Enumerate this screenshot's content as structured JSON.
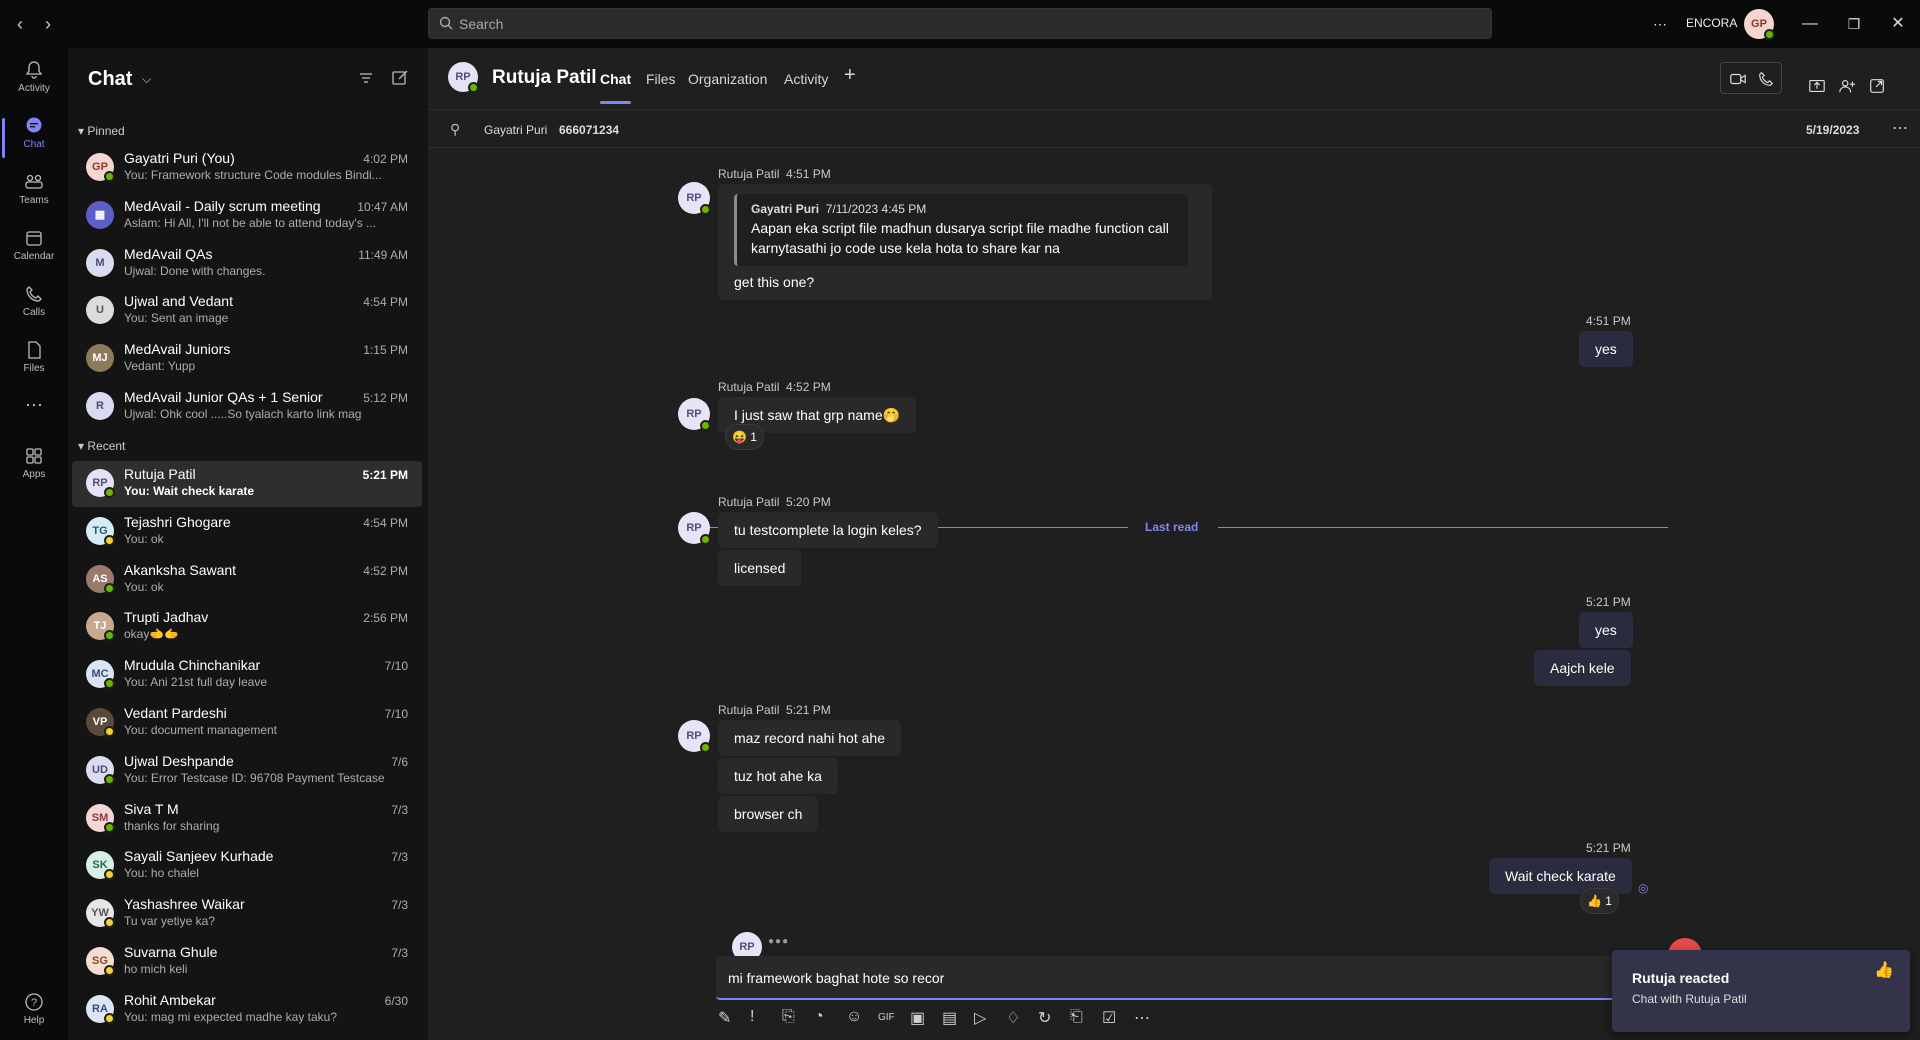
{
  "search": {
    "placeholder": "Search"
  },
  "titlebar": {
    "org": "ENCORA",
    "user_initials": "GP"
  },
  "rail": [
    {
      "label": "Activity",
      "icon": "bell-icon"
    },
    {
      "label": "Chat",
      "icon": "chat-icon"
    },
    {
      "label": "Teams",
      "icon": "teams-icon"
    },
    {
      "label": "Calendar",
      "icon": "calendar-icon"
    },
    {
      "label": "Calls",
      "icon": "phone-icon"
    },
    {
      "label": "Files",
      "icon": "file-icon"
    },
    {
      "label": "",
      "icon": "more-icon"
    },
    {
      "label": "Apps",
      "icon": "apps-icon"
    },
    {
      "label": "Help",
      "icon": "help-icon"
    }
  ],
  "chatlist": {
    "title": "Chat",
    "pinned_label": "Pinned",
    "recent_label": "Recent",
    "pinned": [
      {
        "initials": "GP",
        "name": "Gayatri Puri (You)",
        "preview": "You: Framework structure Code modules Bindi...",
        "time": "4:02 PM",
        "avbg": "#f3d6d0",
        "avfg": "#8a3a2c",
        "status": "online"
      },
      {
        "initials": "▦",
        "name": "MedAvail - Daily scrum meeting",
        "preview": "Aslam: Hi All, I'll not be able to attend today's ...",
        "time": "10:47 AM",
        "avbg": "#5b5fc7",
        "avfg": "#fff",
        "status": ""
      },
      {
        "initials": "M",
        "name": "MedAvail QAs",
        "preview": "Ujwal: Done with changes.",
        "time": "11:49 AM",
        "avbg": "#d9dbf0",
        "avfg": "#4b4b7a",
        "status": ""
      },
      {
        "initials": "U",
        "name": "Ujwal and Vedant",
        "preview": "You: Sent an image",
        "time": "4:54 PM",
        "avbg": "#dcdcdc",
        "avfg": "#555",
        "status": ""
      },
      {
        "initials": "MJ",
        "name": "MedAvail Juniors",
        "preview": "Vedant: Yupp",
        "time": "1:15 PM",
        "avbg": "#8c7a5a",
        "avfg": "#fff",
        "status": ""
      },
      {
        "initials": "R",
        "name": "MedAvail Junior QAs + 1 Senior",
        "preview": "Ujwal: Ohk cool .....So tyalach karto link mag",
        "time": "5:12 PM",
        "avbg": "#d9dbf0",
        "avfg": "#4b4b7a",
        "status": ""
      }
    ],
    "recent": [
      {
        "initials": "RP",
        "name": "Rutuja Patil",
        "preview": "You: Wait check karate",
        "time": "5:21 PM",
        "avbg": "#e6e2f5",
        "avfg": "#4f4f7a",
        "status": "online"
      },
      {
        "initials": "TG",
        "name": "Tejashri Ghogare",
        "preview": "You: ok",
        "time": "4:54 PM",
        "avbg": "#d6ecf5",
        "avfg": "#2a5a70",
        "status": "away"
      },
      {
        "initials": "AS",
        "name": "Akanksha Sawant",
        "preview": "You: ok",
        "time": "4:52 PM",
        "avbg": "#9a7b6b",
        "avfg": "#fff",
        "status": "online"
      },
      {
        "initials": "TJ",
        "name": "Trupti Jadhav",
        "preview": "okay🫲🫱",
        "time": "2:56 PM",
        "avbg": "#c9a98e",
        "avfg": "#fff",
        "status": "online"
      },
      {
        "initials": "MC",
        "name": "Mrudula Chinchanikar",
        "preview": "You: Ani 21st full day leave",
        "time": "7/10",
        "avbg": "#dbe4f5",
        "avfg": "#3a4d7a",
        "status": "online"
      },
      {
        "initials": "VP",
        "name": "Vedant Pardeshi",
        "preview": "You: document management",
        "time": "7/10",
        "avbg": "#5a4a3a",
        "avfg": "#fff",
        "status": "away"
      },
      {
        "initials": "UD",
        "name": "Ujwal Deshpande",
        "preview": "You: Error Testcase ID: 96708 Payment Testcase ID...",
        "time": "7/6",
        "avbg": "#dcdcf0",
        "avfg": "#4b4b7a",
        "status": "online"
      },
      {
        "initials": "SM",
        "name": "Siva T M",
        "preview": "thanks for sharing",
        "time": "7/3",
        "avbg": "#f5d6d6",
        "avfg": "#8a3a3a",
        "status": "online"
      },
      {
        "initials": "SK",
        "name": "Sayali Sanjeev Kurhade",
        "preview": "You: ho chalel",
        "time": "7/3",
        "avbg": "#d6f0e6",
        "avfg": "#2a6a4a",
        "status": "away"
      },
      {
        "initials": "YW",
        "name": "Yashashree Waikar",
        "preview": "Tu var yetiye ka?",
        "time": "7/3",
        "avbg": "#e6e6e6",
        "avfg": "#555",
        "status": "away"
      },
      {
        "initials": "SG",
        "name": "Suvarna Ghule",
        "preview": "ho mich keli",
        "time": "7/3",
        "avbg": "#f5ddd0",
        "avfg": "#8a4a2a",
        "status": "away"
      },
      {
        "initials": "RA",
        "name": "Rohit Ambekar",
        "preview": "You: mag mi expected madhe kay taku?",
        "time": "6/30",
        "avbg": "#dce6f5",
        "avfg": "#3a4d7a",
        "status": "away"
      }
    ]
  },
  "header": {
    "initials": "RP",
    "name": "Rutuja Patil",
    "tabs": [
      "Chat",
      "Files",
      "Organization",
      "Activity"
    ],
    "pinned_name": "Gayatri Puri",
    "pinned_number": "666071234",
    "pinned_date": "5/19/2023"
  },
  "messages": {
    "m1": {
      "sender": "Rutuja Patil",
      "time": "4:51 PM",
      "quote_author": "Gayatri Puri",
      "quote_time": "7/11/2023 4:45 PM",
      "quote_line1": "Aapan eka script file madhun dusarya script file madhe function call",
      "quote_line2": "karnytasathi jo code use kela hota to share kar na",
      "text": "get this one?"
    },
    "m2": {
      "time": "4:51 PM",
      "text": "yes"
    },
    "m3": {
      "sender": "Rutuja Patil",
      "time": "4:52 PM",
      "text": "I just saw that grp name🤭",
      "reaction": "😝 1"
    },
    "last_read": "Last read",
    "m4": {
      "sender": "Rutuja Patil",
      "time": "5:20 PM",
      "text1": "tu testcomplete la login keles?",
      "text2": "licensed"
    },
    "m5": {
      "time": "5:21 PM",
      "text1": "yes",
      "text2": "Aajch kele"
    },
    "m6": {
      "sender": "Rutuja Patil",
      "time": "5:21 PM",
      "text1": "maz record nahi hot ahe",
      "text2": "tuz hot ahe ka",
      "text3": "browser ch"
    },
    "m7": {
      "time": "5:21 PM",
      "text": "Wait check karate",
      "reaction": "👍 1"
    },
    "typing_initials": "RP"
  },
  "compose": {
    "value": "mi framework baghat hote so recor"
  },
  "toast": {
    "title": "Rutuja reacted",
    "subtitle": "Chat with Rutuja Patil"
  }
}
